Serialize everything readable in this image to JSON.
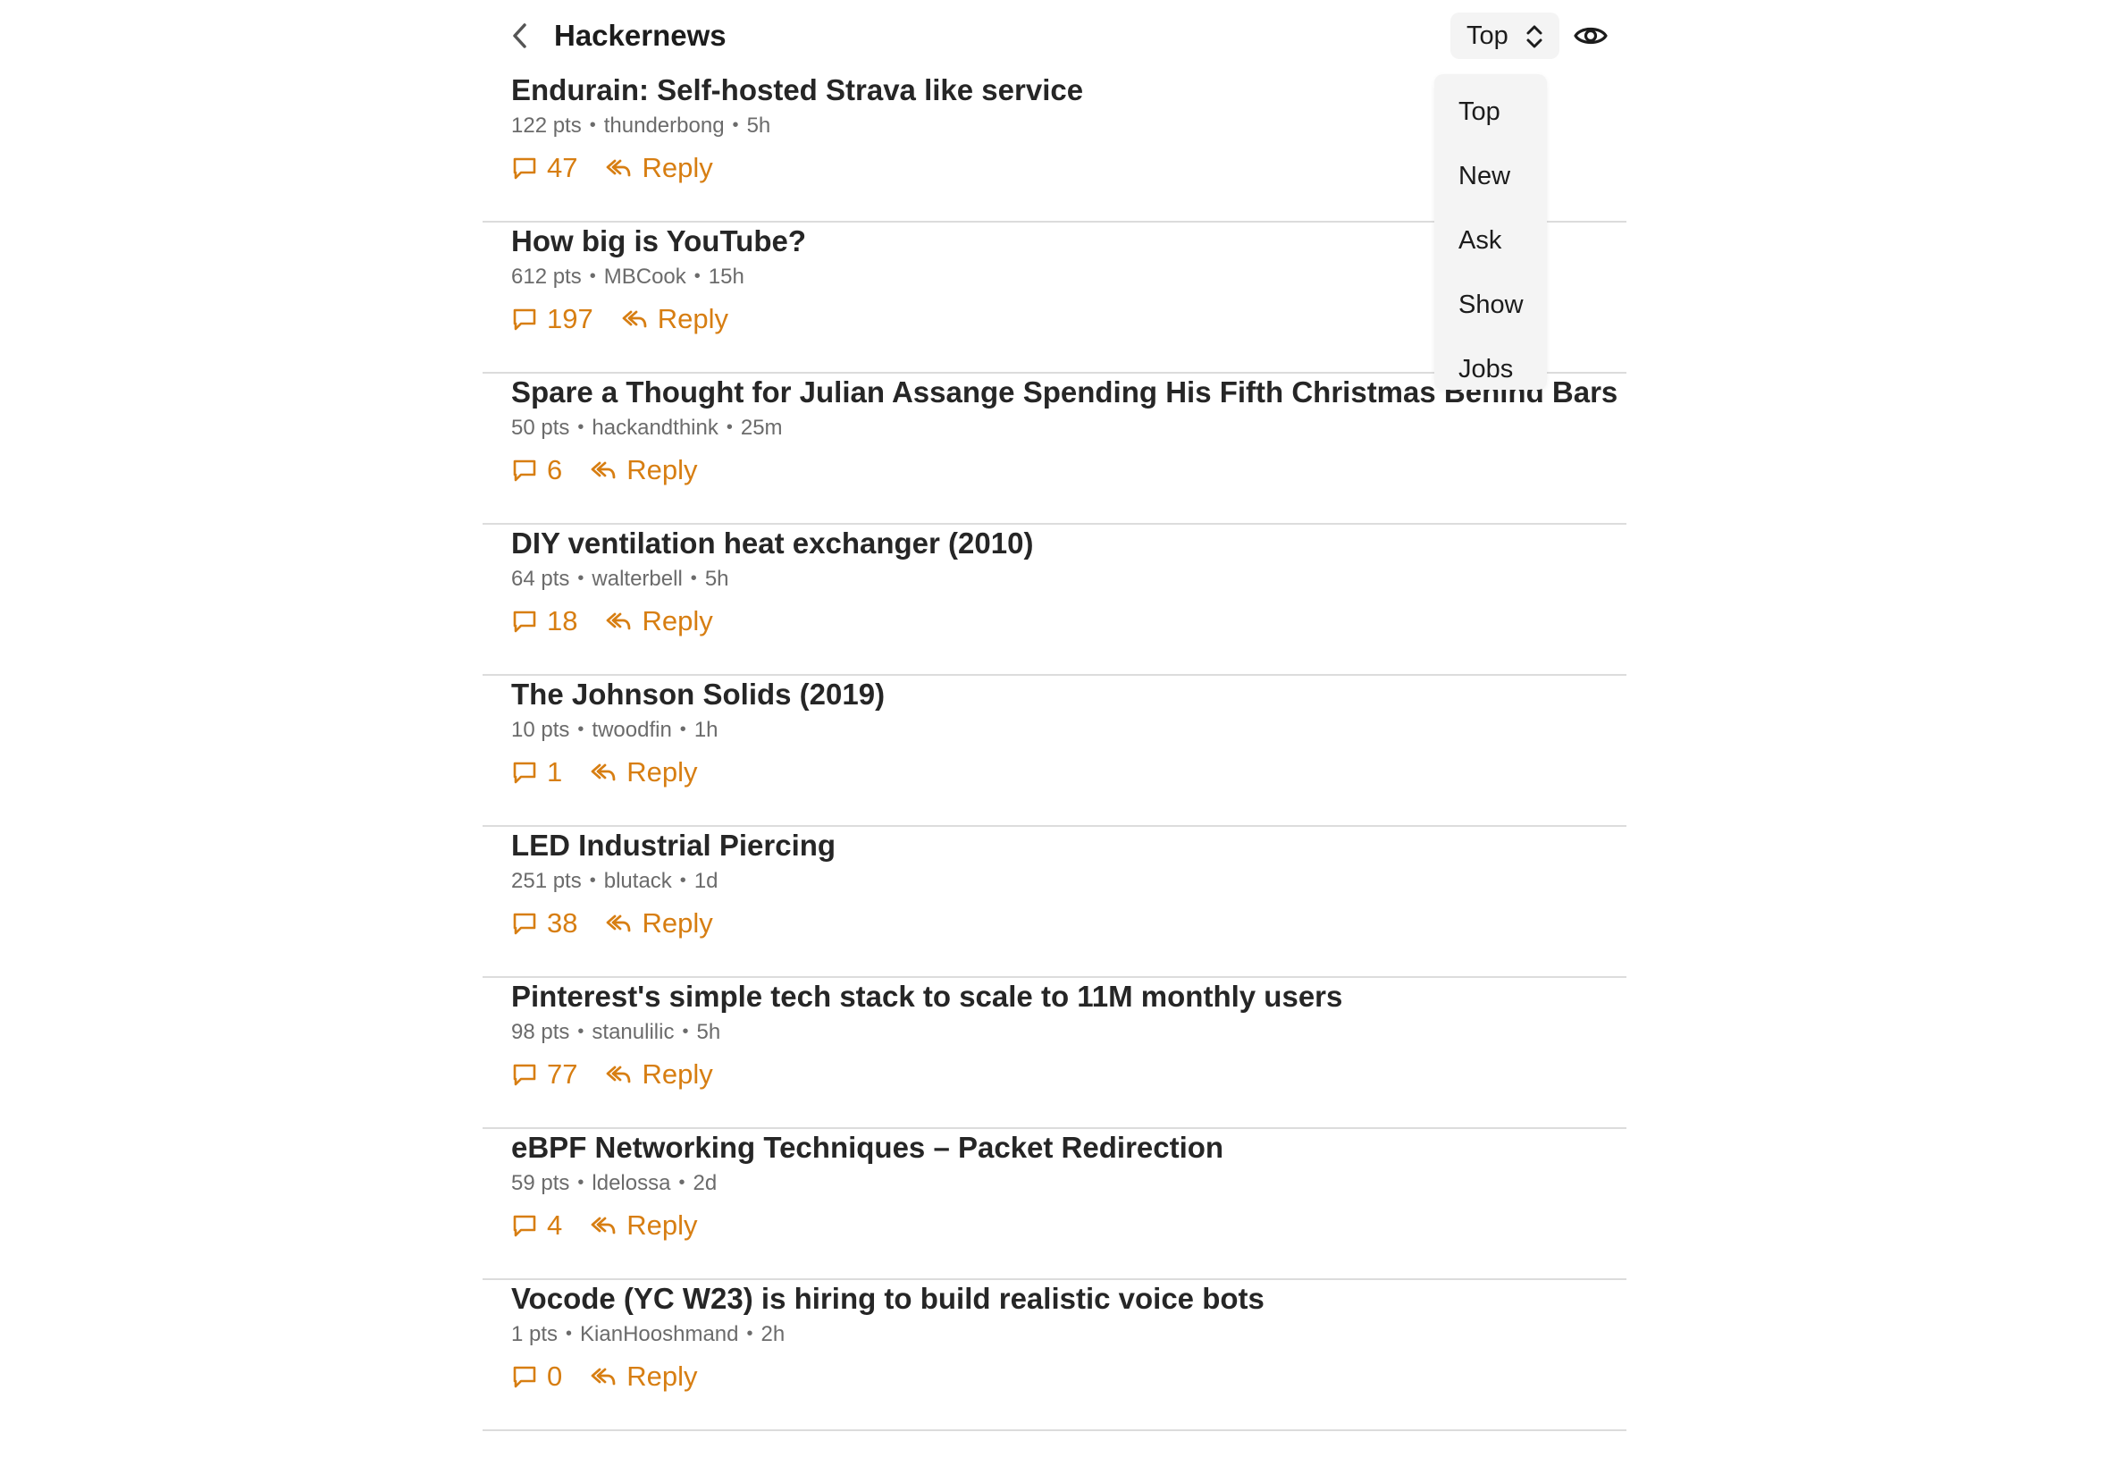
{
  "header": {
    "title": "Hackernews",
    "sort_value": "Top",
    "back_icon": "chevron-left-icon",
    "eye_icon": "eye-icon"
  },
  "dropdown": {
    "items": [
      {
        "label": "Top"
      },
      {
        "label": "New"
      },
      {
        "label": "Ask"
      },
      {
        "label": "Show"
      },
      {
        "label": "Jobs"
      }
    ]
  },
  "colors": {
    "accent": "#d77e12",
    "title": "#262626",
    "meta": "#6b6b6b",
    "divider": "#dcdcdc"
  },
  "stories": [
    {
      "title": "Endurain: Self-hosted Strava like service",
      "points": "122 pts",
      "author": "thunderbong",
      "age": "5h",
      "comments": "47",
      "reply": "Reply"
    },
    {
      "title": "How big is YouTube?",
      "points": "612 pts",
      "author": "MBCook",
      "age": "15h",
      "comments": "197",
      "reply": "Reply"
    },
    {
      "title": "Spare a Thought for Julian Assange Spending His Fifth Christmas Behind Bars",
      "points": "50 pts",
      "author": "hackandthink",
      "age": "25m",
      "comments": "6",
      "reply": "Reply"
    },
    {
      "title": "DIY ventilation heat exchanger (2010)",
      "points": "64 pts",
      "author": "walterbell",
      "age": "5h",
      "comments": "18",
      "reply": "Reply"
    },
    {
      "title": "The Johnson Solids (2019)",
      "points": "10 pts",
      "author": "twoodfin",
      "age": "1h",
      "comments": "1",
      "reply": "Reply"
    },
    {
      "title": "LED Industrial Piercing",
      "points": "251 pts",
      "author": "blutack",
      "age": "1d",
      "comments": "38",
      "reply": "Reply"
    },
    {
      "title": "Pinterest's simple tech stack to scale to 11M monthly users",
      "points": "98 pts",
      "author": "stanulilic",
      "age": "5h",
      "comments": "77",
      "reply": "Reply"
    },
    {
      "title": "eBPF Networking Techniques – Packet Redirection",
      "points": "59 pts",
      "author": "ldelossa",
      "age": "2d",
      "comments": "4",
      "reply": "Reply"
    },
    {
      "title": "Vocode (YC W23) is hiring to build realistic voice bots",
      "points": "1 pts",
      "author": "KianHooshmand",
      "age": "2h",
      "comments": "0",
      "reply": "Reply"
    }
  ]
}
